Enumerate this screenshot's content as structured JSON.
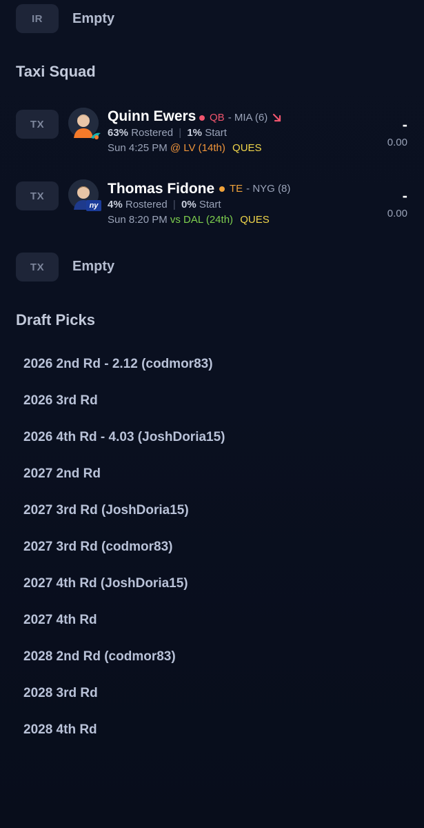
{
  "ir": {
    "badge": "IR",
    "label": "Empty"
  },
  "taxi": {
    "title": "Taxi Squad",
    "players": [
      {
        "badge": "TX",
        "name": "Quinn Ewers",
        "position": "QB",
        "team_info": "- MIA (6)",
        "rostered": "63%",
        "rostered_label": "Rostered",
        "start": "1%",
        "start_label": "Start",
        "game_time": "Sun 4:25 PM",
        "matchup": "@ LV (14th)",
        "status": "QUES",
        "proj": "-",
        "points": "0.00",
        "pos_color": "#f0556e",
        "matchup_color": "#f0953a",
        "trend_icon": "arrow-down-right-icon"
      },
      {
        "badge": "TX",
        "name": "Thomas Fidone",
        "position": "TE",
        "team_info": "- NYG (8)",
        "rostered": "4%",
        "rostered_label": "Rostered",
        "start": "0%",
        "start_label": "Start",
        "game_time": "Sun 8:20 PM",
        "matchup": "vs DAL (24th)",
        "status": "QUES",
        "proj": "-",
        "points": "0.00",
        "pos_color": "#f0a23a",
        "matchup_color": "#7ed04e"
      }
    ],
    "empty_slot": {
      "badge": "TX",
      "label": "Empty"
    }
  },
  "draft": {
    "title": "Draft Picks",
    "picks": [
      "2026 2nd Rd - 2.12 (codmor83)",
      "2026 3rd Rd",
      "2026 4th Rd - 4.03 (JoshDoria15)",
      "2027 2nd Rd",
      "2027 3rd Rd (JoshDoria15)",
      "2027 3rd Rd (codmor83)",
      "2027 4th Rd (JoshDoria15)",
      "2027 4th Rd",
      "2028 2nd Rd (codmor83)",
      "2028 3rd Rd",
      "2028 4th Rd"
    ]
  }
}
